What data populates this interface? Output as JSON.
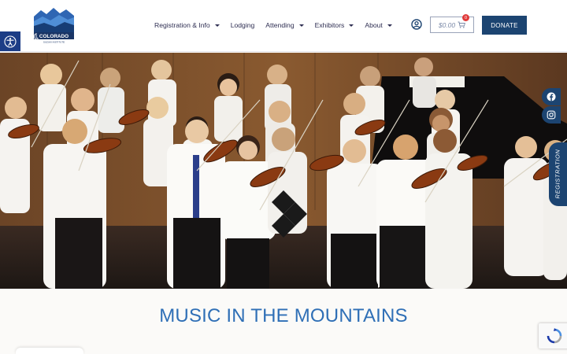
{
  "logo": {
    "text": "COLORADO",
    "subtext": "SUZUKI INSTITUTE"
  },
  "nav": [
    {
      "label": "Registration & Info",
      "dropdown": true
    },
    {
      "label": "Lodging",
      "dropdown": false
    },
    {
      "label": "Attending",
      "dropdown": true
    },
    {
      "label": "Exhibitors",
      "dropdown": true
    },
    {
      "label": "About",
      "dropdown": true
    }
  ],
  "cart": {
    "amount": "$0.00",
    "count": "0"
  },
  "donate_label": "DONATE",
  "registration_tab": "REGISTRATION",
  "headline": "MUSIC IN THE MOUNTAINS",
  "icons": {
    "accessibility": "accessibility-icon",
    "user": "user-account-icon",
    "cart": "cart-icon",
    "facebook": "facebook-icon",
    "instagram": "instagram-icon",
    "recaptcha": "recaptcha-icon"
  },
  "colors": {
    "brand_navy": "#1c4471",
    "headline_blue": "#2f6fb6",
    "accessibility_blue": "#1c3d86"
  }
}
